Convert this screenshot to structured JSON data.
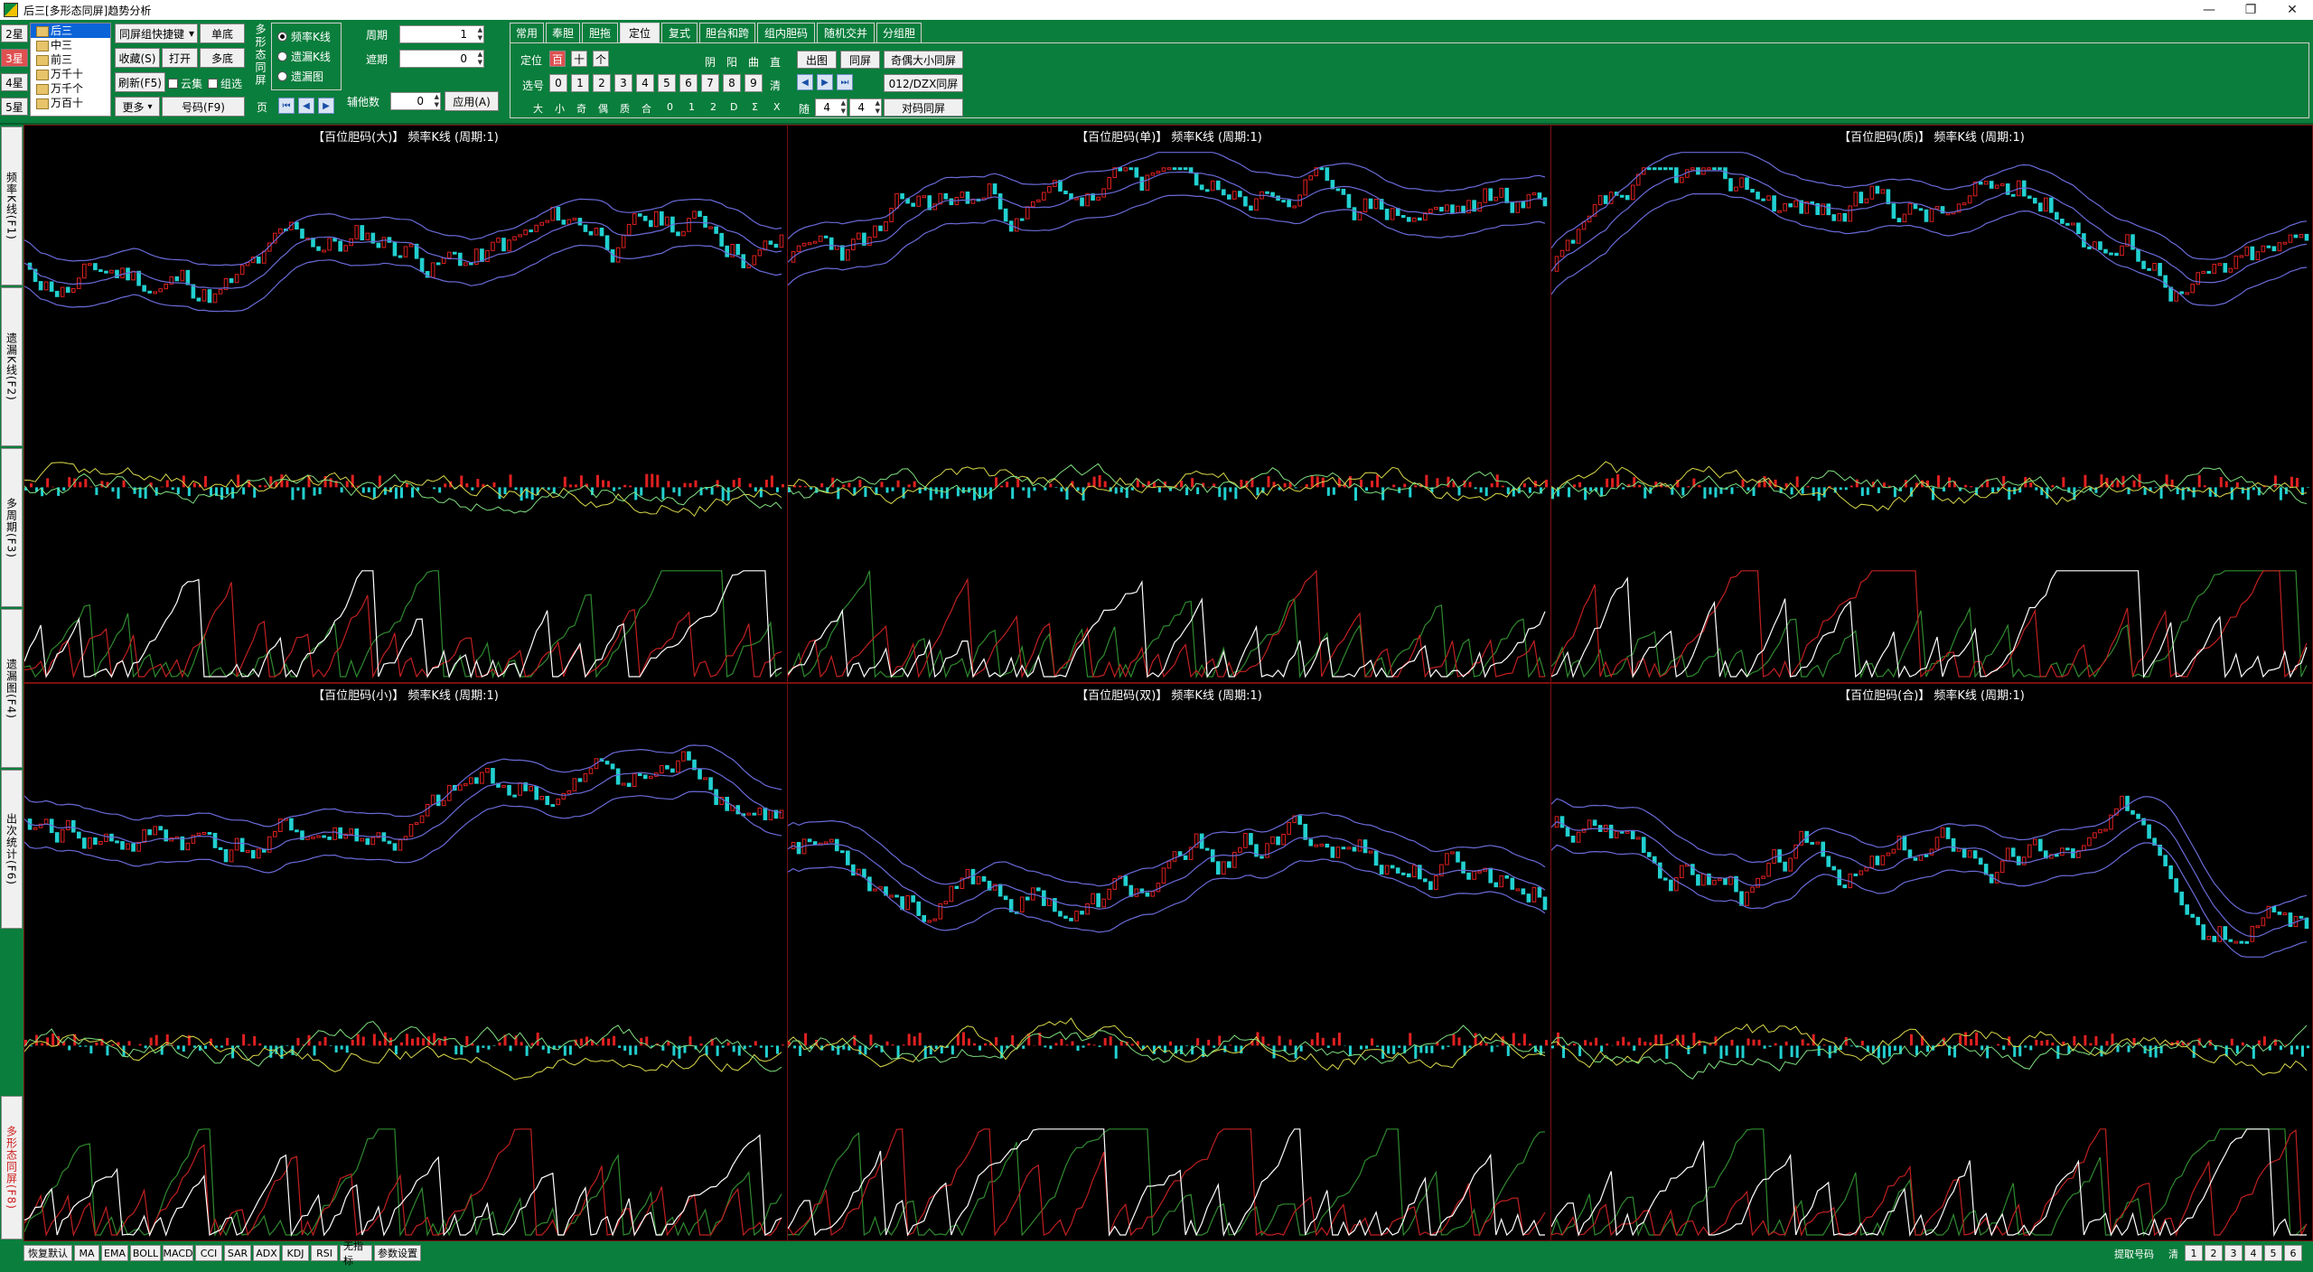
{
  "window": {
    "title": "后三[多形态同屏]趋势分析",
    "minimize": "—",
    "restore": "❐",
    "close": "✕"
  },
  "left_stars": [
    "2星",
    "3星",
    "4星",
    "5星"
  ],
  "position_list": {
    "items": [
      "后三",
      "中三",
      "前三",
      "万千十",
      "万千个",
      "万百十"
    ]
  },
  "controls": {
    "combo": "同屏组快捷键",
    "single_bottom": "单底",
    "favorite": "收藏(S)",
    "open": "打开",
    "multi_bottom": "多底",
    "refresh": "刷新(F5)",
    "check_yuji": "云集",
    "check_zuxuan": "组选",
    "more": "更多",
    "number_f9": "号码(F9)"
  },
  "mode_group": {
    "title": "多形态同屏",
    "options": [
      "频率K线",
      "遗漏K线",
      "遗漏图"
    ],
    "selected": 0,
    "page": "页"
  },
  "params": {
    "period_label": "周期",
    "period_value": "1",
    "lag_label": "遮期",
    "lag_value": "0",
    "extra_label": "辅他数",
    "extra_value": "0",
    "apply": "应用(A)"
  },
  "tabs": [
    "常用",
    "奉胆",
    "胆拖",
    "定位",
    "复式",
    "胆台和跨",
    "组内胆码",
    "随机交并",
    "分组胆"
  ],
  "active_tab": 3,
  "locate": {
    "label": "定位",
    "digits_pos": [
      "百",
      "十",
      "个"
    ],
    "select_label": "选号",
    "digits": [
      "0",
      "1",
      "2",
      "3",
      "4",
      "5",
      "6",
      "7",
      "8",
      "9"
    ],
    "yin_yang": [
      "阴",
      "阳",
      "曲",
      "直"
    ],
    "clear": "清",
    "chars": [
      "大",
      "小",
      "奇",
      "偶",
      "质",
      "合",
      "0",
      "1",
      "2",
      "D",
      "Σ",
      "X"
    ],
    "show_chart": "出图",
    "same_screen": "同屏",
    "odd_even_bs": "奇偶大小同屏",
    "dzx": "012/DZX同屏",
    "random_label": "随",
    "random_a": "4",
    "random_b": "4",
    "pair_screen": "对码同屏"
  },
  "rail": [
    "频率K线(F1)",
    "遗漏K线(F2)",
    "多周期(F3)",
    "遗漏图(F4)",
    "出次统计(F6)",
    "多形态同屏(F8)"
  ],
  "charts": [
    {
      "title": "【百位胆码(大)】 频率K线 (周期:1)",
      "seed": 11
    },
    {
      "title": "【百位胆码(单)】 频率K线 (周期:1)",
      "seed": 23
    },
    {
      "title": "【百位胆码(质)】 频率K线 (周期:1)",
      "seed": 37
    },
    {
      "title": "【百位胆码(小)】 频率K线 (周期:1)",
      "seed": 41
    },
    {
      "title": "【百位胆码(双)】 频率K线 (周期:1)",
      "seed": 53
    },
    {
      "title": "【百位胆码(合)】 频率K线 (周期:1)",
      "seed": 67
    }
  ],
  "indicators": [
    "恢复默认",
    "MA",
    "EMA",
    "BOLL",
    "MACD",
    "CCI",
    "SAR",
    "ADX",
    "KDJ",
    "RSI",
    "无指标",
    "参数设置"
  ],
  "status": {
    "fetch": "提取号码",
    "clear": "清",
    "pages": [
      "1",
      "2",
      "3",
      "4",
      "5",
      "6"
    ]
  },
  "colors": {
    "toolbar": "#0a7e3c",
    "up": "#e02020",
    "down": "#22d0d0",
    "band": "#6a6ad8",
    "white": "#ffffff"
  }
}
